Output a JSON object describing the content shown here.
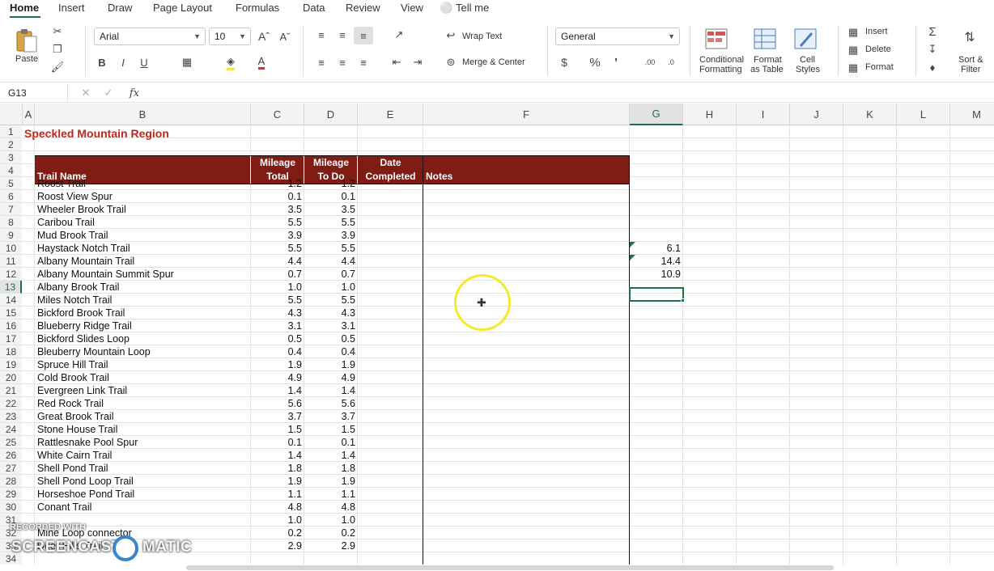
{
  "ribbon_tabs": [
    "Home",
    "Insert",
    "Draw",
    "Page Layout",
    "Formulas",
    "Data",
    "Review",
    "View",
    "Tell me"
  ],
  "clipboard": {
    "paste_label": "Paste"
  },
  "font": {
    "name": "Arial",
    "size": "10"
  },
  "alignment": {
    "wrap_text": "Wrap Text",
    "merge_center": "Merge & Center"
  },
  "number": {
    "format": "General"
  },
  "styles": {
    "conditional_line1": "Conditional",
    "conditional_line2": "Formatting",
    "format_table_line1": "Format",
    "format_table_line2": "as Table",
    "cell_styles_line1": "Cell",
    "cell_styles_line2": "Styles"
  },
  "cells_group": {
    "insert": "Insert",
    "delete": "Delete",
    "format": "Format"
  },
  "editing": {
    "sort_line1": "Sort &",
    "sort_line2": "Filter"
  },
  "formula_bar": {
    "name_box": "G13",
    "fx": "fx",
    "formula": ""
  },
  "columns": [
    "A",
    "B",
    "C",
    "D",
    "E",
    "F",
    "G",
    "H",
    "I",
    "J",
    "K",
    "L",
    "M"
  ],
  "selected_cell": {
    "column": "G",
    "row": 13
  },
  "sheet": {
    "title": "Speckled Mountain Region",
    "headers": {
      "trail_name": "Trail Name",
      "mileage_total_1": "Mileage",
      "mileage_total_2": "Total",
      "mileage_todo_1": "Mileage",
      "mileage_todo_2": "To Do",
      "date_1": "Date",
      "date_2": "Completed",
      "notes": "Notes"
    },
    "rows": [
      {
        "row": 5,
        "name": "Roost Trail",
        "total": "1.2",
        "todo": "1.2"
      },
      {
        "row": 6,
        "name": "Roost View Spur",
        "total": "0.1",
        "todo": "0.1"
      },
      {
        "row": 7,
        "name": "Wheeler Brook Trail",
        "total": "3.5",
        "todo": "3.5"
      },
      {
        "row": 8,
        "name": "Caribou Trail",
        "total": "5.5",
        "todo": "5.5"
      },
      {
        "row": 9,
        "name": "Mud Brook Trail",
        "total": "3.9",
        "todo": "3.9"
      },
      {
        "row": 10,
        "name": "Haystack Notch Trail",
        "total": "5.5",
        "todo": "5.5"
      },
      {
        "row": 11,
        "name": "Albany Mountain Trail",
        "total": "4.4",
        "todo": "4.4"
      },
      {
        "row": 12,
        "name": "Albany Mountain Summit Spur",
        "total": "0.7",
        "todo": "0.7"
      },
      {
        "row": 13,
        "name": "Albany Brook Trail",
        "total": "1.0",
        "todo": "1.0"
      },
      {
        "row": 14,
        "name": "Miles Notch Trail",
        "total": "5.5",
        "todo": "5.5"
      },
      {
        "row": 15,
        "name": "Bickford Brook Trail",
        "total": "4.3",
        "todo": "4.3"
      },
      {
        "row": 16,
        "name": "Blueberry Ridge Trail",
        "total": "3.1",
        "todo": "3.1"
      },
      {
        "row": 17,
        "name": "Bickford Slides Loop",
        "total": "0.5",
        "todo": "0.5"
      },
      {
        "row": 18,
        "name": "Bleuberry Mountain Loop",
        "total": "0.4",
        "todo": "0.4"
      },
      {
        "row": 19,
        "name": "Spruce Hill Trail",
        "total": "1.9",
        "todo": "1.9"
      },
      {
        "row": 20,
        "name": "Cold Brook Trail",
        "total": "4.9",
        "todo": "4.9"
      },
      {
        "row": 21,
        "name": "Evergreen Link Trail",
        "total": "1.4",
        "todo": "1.4"
      },
      {
        "row": 22,
        "name": "Red Rock Trail",
        "total": "5.6",
        "todo": "5.6"
      },
      {
        "row": 23,
        "name": "Great Brook Trail",
        "total": "3.7",
        "todo": "3.7"
      },
      {
        "row": 24,
        "name": "Stone House Trail",
        "total": "1.5",
        "todo": "1.5"
      },
      {
        "row": 25,
        "name": "Rattlesnake Pool Spur",
        "total": "0.1",
        "todo": "0.1"
      },
      {
        "row": 26,
        "name": "White Cairn Trail",
        "total": "1.4",
        "todo": "1.4"
      },
      {
        "row": 27,
        "name": "Shell Pond Trail",
        "total": "1.8",
        "todo": "1.8"
      },
      {
        "row": 28,
        "name": "Shell Pond Loop Trail",
        "total": "1.9",
        "todo": "1.9"
      },
      {
        "row": 29,
        "name": "Horseshoe Pond Trail",
        "total": "1.1",
        "todo": "1.1"
      },
      {
        "row": 30,
        "name": "Conant Trail",
        "total": "4.8",
        "todo": "4.8"
      },
      {
        "row": 31,
        "name": "",
        "total": "1.0",
        "todo": "1.0"
      },
      {
        "row": 32,
        "name": "Mine Loop connector",
        "total": "0.2",
        "todo": "0.2"
      },
      {
        "row": 33,
        "name": "Deer Hills Trail",
        "total": "2.9",
        "todo": "2.9"
      }
    ],
    "g_values": [
      {
        "row": 10,
        "value": "6.1"
      },
      {
        "row": 11,
        "value": "14.4"
      },
      {
        "row": 12,
        "value": "10.9"
      }
    ]
  },
  "watermark": {
    "line1": "RECORDED WITH",
    "line2_a": "SCREENCAST",
    "line2_b": "MATIC"
  },
  "colors": {
    "header_band": "#7f1d14",
    "title_red": "#c0261b",
    "accent_green": "#1e7145",
    "cursor_ring": "#f2ea2c"
  }
}
